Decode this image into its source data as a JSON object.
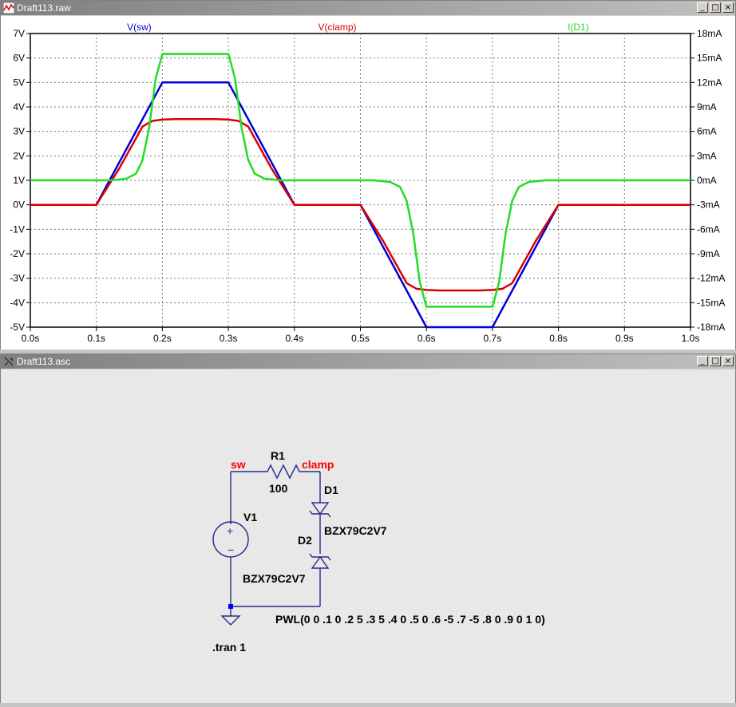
{
  "plot_window": {
    "title": "Draft113.raw",
    "min_label": "_",
    "max_label": "□",
    "close_label": "×"
  },
  "schematic_window": {
    "title": "Draft113.asc",
    "min_label": "_",
    "max_label": "□",
    "close_label": "×"
  },
  "colors": {
    "v_sw": "#0000d8",
    "v_clamp": "#d80000",
    "i_d1": "#22dd22",
    "schematic_wire": "#2a2a8a",
    "net_label": "#ff0000",
    "ground_node": "#0000ff"
  },
  "chart_data": {
    "type": "line",
    "x_ticks": [
      "0.0s",
      "0.1s",
      "0.2s",
      "0.3s",
      "0.4s",
      "0.5s",
      "0.6s",
      "0.7s",
      "0.8s",
      "0.9s",
      "1.0s"
    ],
    "xlim": [
      0,
      1.0
    ],
    "y_left_ticks": [
      "7V",
      "6V",
      "5V",
      "4V",
      "3V",
      "2V",
      "1V",
      "0V",
      "-1V",
      "-2V",
      "-3V",
      "-4V",
      "-5V"
    ],
    "ylim_left": [
      -5,
      7
    ],
    "y_right_ticks": [
      "18mA",
      "15mA",
      "12mA",
      "9mA",
      "6mA",
      "3mA",
      "0mA",
      "-3mA",
      "-6mA",
      "-9mA",
      "-12mA",
      "-15mA",
      "-18mA"
    ],
    "ylim_right": [
      -18,
      18
    ],
    "grid": true,
    "series": [
      {
        "name": "V(sw)",
        "axis": "left",
        "x": [
          0,
          0.1,
          0.2,
          0.3,
          0.4,
          0.5,
          0.6,
          0.7,
          0.8,
          0.9,
          1.0
        ],
        "y": [
          0,
          0,
          5,
          5,
          0,
          0,
          -5,
          -5,
          0,
          0,
          0
        ]
      },
      {
        "name": "V(clamp)",
        "axis": "left",
        "x": [
          0,
          0.1,
          0.135,
          0.17,
          0.185,
          0.2,
          0.22,
          0.28,
          0.3,
          0.315,
          0.33,
          0.365,
          0.4,
          0.5,
          0.535,
          0.57,
          0.585,
          0.6,
          0.62,
          0.68,
          0.7,
          0.715,
          0.73,
          0.765,
          0.8,
          1.0
        ],
        "y": [
          0,
          0,
          1.5,
          3.2,
          3.43,
          3.48,
          3.5,
          3.5,
          3.48,
          3.43,
          3.2,
          1.5,
          0,
          0,
          -1.5,
          -3.2,
          -3.43,
          -3.48,
          -3.5,
          -3.5,
          -3.48,
          -3.43,
          -3.2,
          -1.5,
          0,
          0
        ]
      },
      {
        "name": "I(D1)",
        "axis": "right",
        "x": [
          0,
          0.12,
          0.145,
          0.16,
          0.17,
          0.18,
          0.19,
          0.2,
          0.3,
          0.31,
          0.32,
          0.33,
          0.34,
          0.355,
          0.38,
          0.52,
          0.545,
          0.56,
          0.57,
          0.58,
          0.59,
          0.6,
          0.7,
          0.71,
          0.72,
          0.73,
          0.74,
          0.755,
          0.78,
          1.0
        ],
        "y": [
          0,
          0,
          0.2,
          0.8,
          2.5,
          6.5,
          12.5,
          15.5,
          15.5,
          12.5,
          6.5,
          2.5,
          0.8,
          0.2,
          0,
          0,
          -0.2,
          -0.8,
          -2.5,
          -6.5,
          -12.5,
          -15.5,
          -15.5,
          -12.5,
          -6.5,
          -2.5,
          -0.8,
          -0.2,
          0,
          0
        ]
      }
    ]
  },
  "schematic": {
    "net_sw": "sw",
    "net_clamp": "clamp",
    "r1_name": "R1",
    "r1_value": "100",
    "v1_name": "V1",
    "d1_name": "D1",
    "d1_model": "BZX79C2V7",
    "d2_name": "D2",
    "d2_model": "BZX79C2V7",
    "v1_value": "PWL(0 0 .1 0 .2 5 .3 5 .4 0 .5 0 .6 -5 .7 -5 .8 0 .9 0 1 0)",
    "directive": ".tran 1"
  }
}
